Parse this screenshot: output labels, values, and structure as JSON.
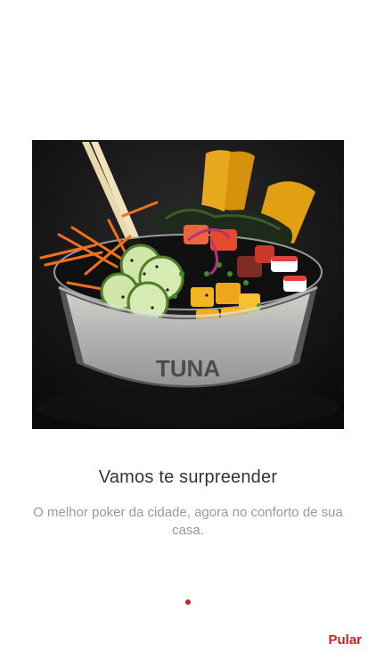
{
  "onboarding": {
    "title": "Vamos te surpreender",
    "subtitle": "O melhor poker da cidade, agora no conforto de sua casa.",
    "skip_label": "Pular",
    "hero_image": {
      "bowl_text": "TUNA"
    },
    "pager": {
      "current": 1,
      "total": 1
    }
  },
  "colors": {
    "accent": "#d21f26",
    "title": "#333333",
    "subtitle": "#9a9a9a",
    "background": "#ffffff"
  }
}
